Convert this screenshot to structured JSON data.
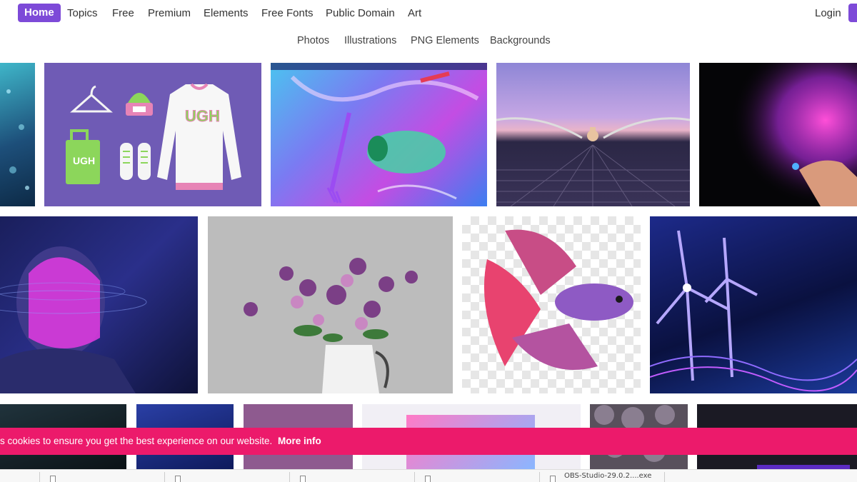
{
  "nav": {
    "home": "Home",
    "items": [
      "Topics",
      "Free",
      "Premium",
      "Elements",
      "Free Fonts",
      "Public Domain",
      "Art"
    ],
    "login": "Login"
  },
  "subnav": {
    "items": [
      "Photos",
      "Illustrations",
      "PNG Elements",
      "Backgrounds"
    ]
  },
  "gallery": {
    "mockup_text_sweater": "UGH",
    "mockup_text_bag": "UGH"
  },
  "cookie": {
    "text": "s cookies to ensure you get the best experience on our website.",
    "link": "More info"
  },
  "downloads": {
    "filename": "OBS-Studio-29.0.2....exe"
  },
  "colors": {
    "brand": "#7d4ad8",
    "cookie_banner": "#ec1a6b"
  }
}
